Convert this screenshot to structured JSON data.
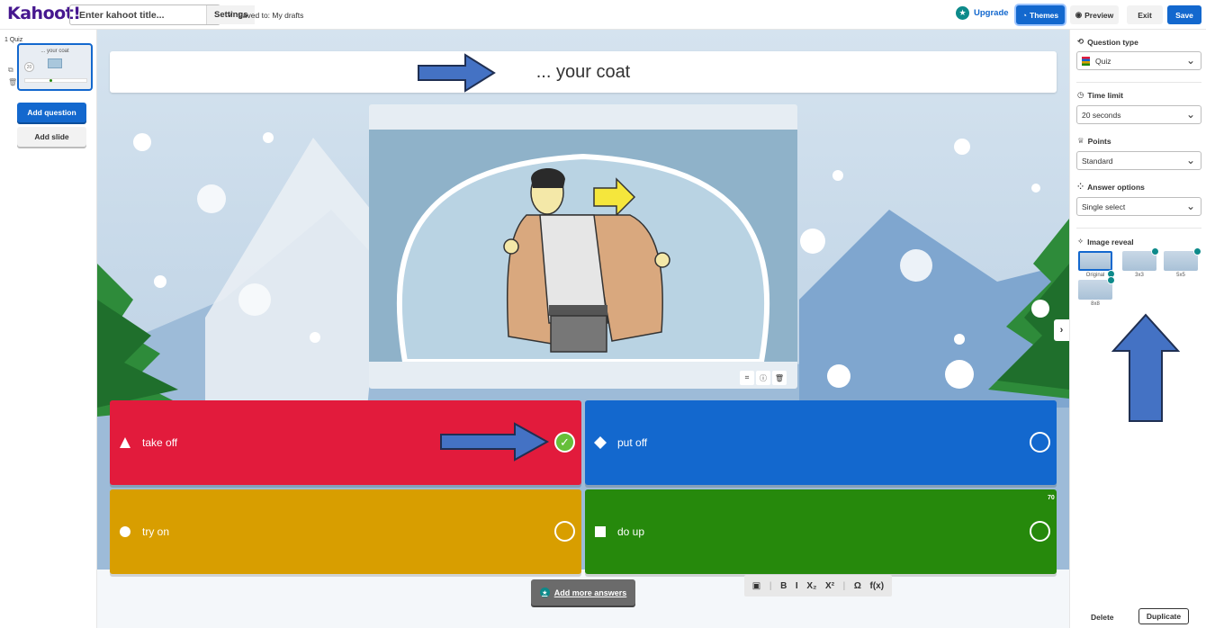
{
  "header": {
    "logo": "Kahoot!",
    "title_placeholder": "Enter kahoot title...",
    "settings_label": "Settings",
    "saved_text": "Saved to: My drafts",
    "upgrade_label": "Upgrade",
    "themes_label": "Themes",
    "preview_label": "Preview",
    "exit_label": "Exit",
    "save_label": "Save"
  },
  "sidebar": {
    "slide_label": "1  Quiz",
    "thumb_title": "... your coat",
    "thumb_timer": "20",
    "add_question_label": "Add question",
    "add_slide_label": "Add slide"
  },
  "question": {
    "text": "... your coat"
  },
  "answers": [
    {
      "text": "take off",
      "color": "#e21b3c",
      "shape": "triangle",
      "correct": true
    },
    {
      "text": "put off",
      "color": "#1368ce",
      "shape": "diamond",
      "correct": false
    },
    {
      "text": "try on",
      "color": "#d89e00",
      "shape": "circle",
      "correct": false
    },
    {
      "text": "do up",
      "color": "#26890c",
      "shape": "square",
      "correct": false
    }
  ],
  "char_counter": "70",
  "add_more_answers_label": "Add more answers",
  "format_bar": {
    "bold": "B",
    "italic": "I",
    "subscript": "X₂",
    "superscript": "X²",
    "omega": "Ω",
    "function": "f(x)"
  },
  "right_panel": {
    "question_type_label": "Question type",
    "question_type_value": "Quiz",
    "time_limit_label": "Time limit",
    "time_limit_value": "20 seconds",
    "points_label": "Points",
    "points_value": "Standard",
    "answer_options_label": "Answer options",
    "answer_options_value": "Single select",
    "image_reveal_label": "Image reveal",
    "reveal_options": [
      "Original",
      "3x3",
      "5x5",
      "8x8"
    ],
    "delete_label": "Delete",
    "duplicate_label": "Duplicate"
  },
  "colors": {
    "accent": "#1368ce",
    "brand": "#46178f",
    "annotation_arrow": "#4472c4"
  }
}
